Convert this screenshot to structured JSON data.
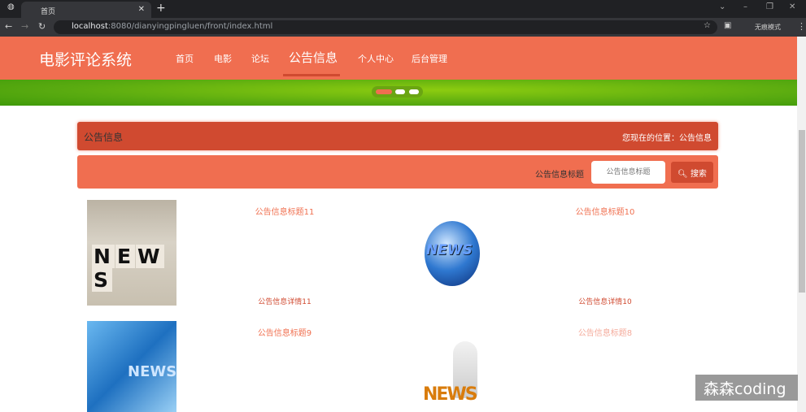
{
  "browser": {
    "tab_title": "首页",
    "url_host": "localhost",
    "url_path": ":8080/dianyingpingluen/front/index.html",
    "profile": "无痕模式"
  },
  "nav": {
    "logo": "电影评论系统",
    "items": [
      "首页",
      "电影",
      "论坛",
      "公告信息",
      "个人中心",
      "后台管理"
    ],
    "active": "公告信息"
  },
  "header": {
    "title": "公告信息",
    "breadcrumb": "您现在的位置：公告信息"
  },
  "search": {
    "label": "公告信息标题",
    "placeholder": "公告信息标题",
    "button": "搜索"
  },
  "notices": [
    {
      "title": "公告信息标题11",
      "detail": "公告信息详情11",
      "image_text": "NEWS"
    },
    {
      "title": "公告信息标题10",
      "detail": "公告信息详情10",
      "image_text": "NEWS"
    },
    {
      "title": "公告信息标题9",
      "image_text": "NEWS"
    },
    {
      "title": "公告信息标题8",
      "image_text": "NEWS"
    }
  ],
  "watermark": "森森coding",
  "colors": {
    "nav": "#f06e50",
    "header": "#d04a30",
    "banner": "#6ab810"
  }
}
